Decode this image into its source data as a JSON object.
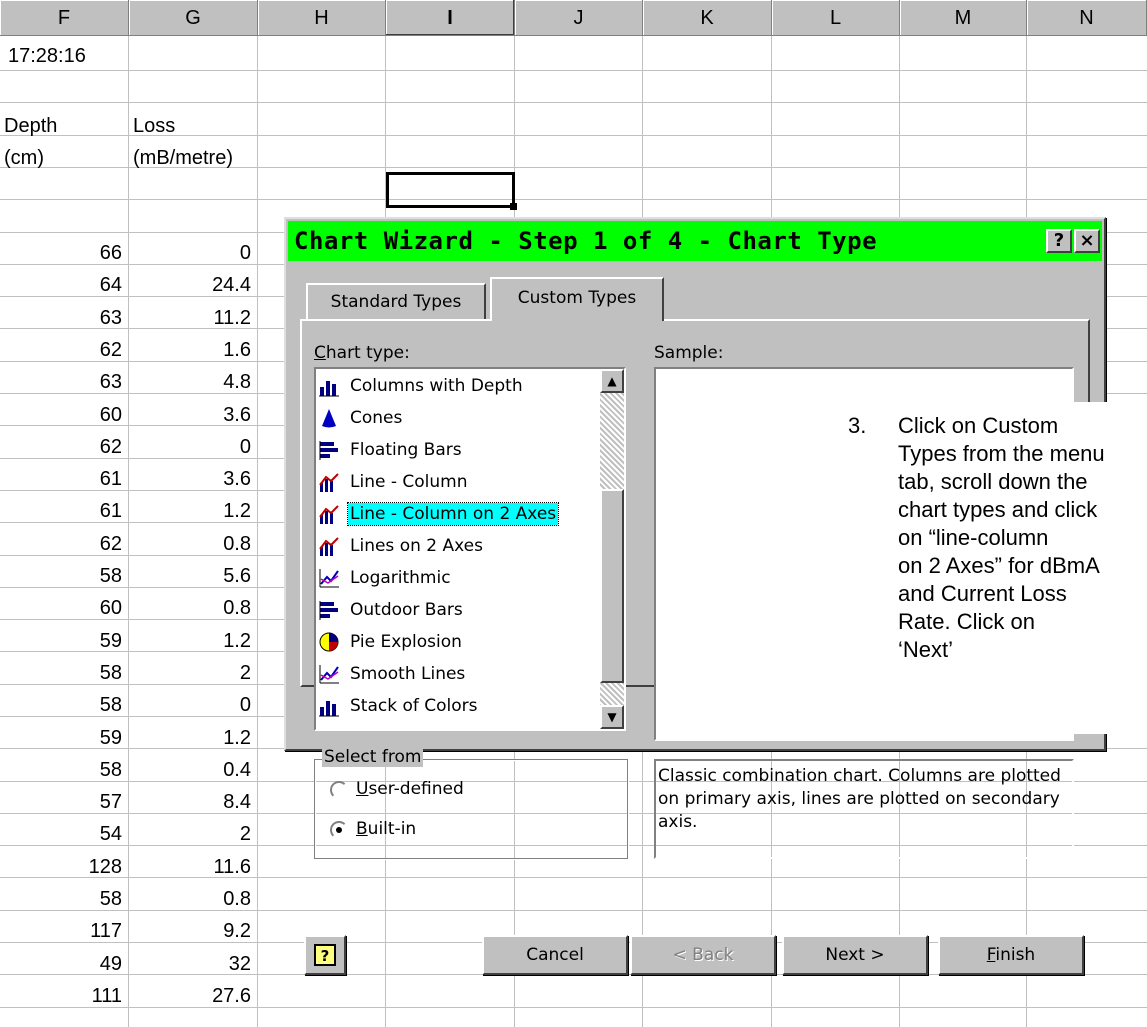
{
  "sheet": {
    "columns": [
      "F",
      "G",
      "H",
      "I",
      "J",
      "K",
      "L",
      "M",
      "N"
    ],
    "active_column": "I",
    "time": "17:28:16",
    "header_row1": [
      "Depth",
      "Loss"
    ],
    "header_row2": [
      "(cm)",
      "(mB/metre)"
    ],
    "rows": [
      [
        "66",
        "0"
      ],
      [
        "64",
        "24.4"
      ],
      [
        "63",
        "11.2"
      ],
      [
        "62",
        "1.6"
      ],
      [
        "63",
        "4.8"
      ],
      [
        "60",
        "3.6"
      ],
      [
        "62",
        "0"
      ],
      [
        "61",
        "3.6"
      ],
      [
        "61",
        "1.2"
      ],
      [
        "62",
        "0.8"
      ],
      [
        "58",
        "5.6"
      ],
      [
        "60",
        "0.8"
      ],
      [
        "59",
        "1.2"
      ],
      [
        "58",
        "2"
      ],
      [
        "58",
        "0"
      ],
      [
        "59",
        "1.2"
      ],
      [
        "58",
        "0.4"
      ],
      [
        "57",
        "8.4"
      ],
      [
        "54",
        "2"
      ],
      [
        "128",
        "11.6"
      ],
      [
        "58",
        "0.8"
      ],
      [
        "117",
        "9.2"
      ],
      [
        "49",
        "32"
      ],
      [
        "111",
        "27.6"
      ]
    ]
  },
  "dialog": {
    "title": "Chart Wizard - Step 1 of 4 - Chart Type",
    "help_btn": "?",
    "close_btn": "×",
    "tabs": {
      "standard": "Standard Types",
      "custom": "Custom Types"
    },
    "chart_type_label": "Chart type:",
    "sample_label": "Sample:",
    "chart_types": [
      {
        "label": "Columns with Depth",
        "icon": "column-chart-icon"
      },
      {
        "label": "Cones",
        "icon": "cone-icon"
      },
      {
        "label": "Floating Bars",
        "icon": "floating-bars-icon"
      },
      {
        "label": "Line - Column",
        "icon": "line-column-icon"
      },
      {
        "label": "Line - Column on 2 Axes",
        "icon": "line-column-icon"
      },
      {
        "label": "Lines on 2 Axes",
        "icon": "line-column-icon"
      },
      {
        "label": "Logarithmic",
        "icon": "line-chart-icon"
      },
      {
        "label": "Outdoor Bars",
        "icon": "floating-bars-icon"
      },
      {
        "label": "Pie Explosion",
        "icon": "pie-chart-icon"
      },
      {
        "label": "Smooth Lines",
        "icon": "line-chart-icon"
      },
      {
        "label": "Stack of Colors",
        "icon": "column-chart-icon"
      }
    ],
    "selected_index": 4,
    "select_from": {
      "title": "Select from",
      "options": [
        "User-defined",
        "Built-in"
      ],
      "selected": "Built-in"
    },
    "description": "Classic combination chart. Columns are plotted on primary axis, lines are plotted on secondary axis.",
    "buttons": {
      "help": "?",
      "cancel": "Cancel",
      "back": "< Back",
      "next": "Next >",
      "finish": "Finish"
    },
    "highlight_color": "#00ffff",
    "titlebar_color": "#00ff00"
  },
  "note": {
    "number": "3.",
    "text": "Click on Custom\nTypes from the menu\ntab, scroll down the\nchart types and click\non “line-column\non 2 Axes” for dBmA\nand Current Loss\nRate. Click on\n‘Next’"
  }
}
